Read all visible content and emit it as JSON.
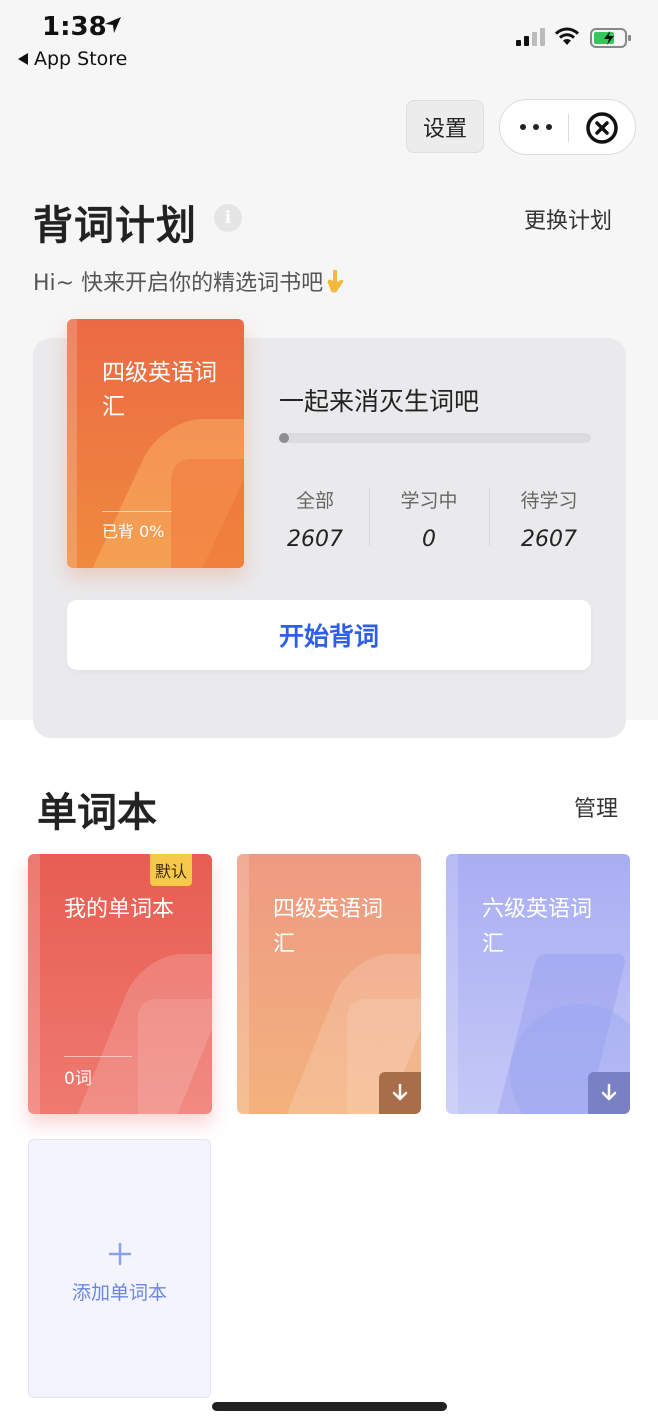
{
  "status_bar": {
    "time": "1:38",
    "back_label": "App Store"
  },
  "capsule": {
    "settings_label": "设置"
  },
  "plan": {
    "title": "背词计划",
    "info_icon": "i",
    "change_label": "更换计划",
    "greeting": "Hi~ 快来开启你的精选词书吧",
    "book": {
      "title": "四级英语词汇",
      "progress_text": "已背 0%"
    },
    "card_heading": "一起来消灭生词吧",
    "progress_fraction": 0,
    "stats": [
      {
        "label": "全部",
        "value": "2607"
      },
      {
        "label": "学习中",
        "value": "0"
      },
      {
        "label": "待学习",
        "value": "2607"
      }
    ],
    "start_label": "开始背词"
  },
  "wordbooks": {
    "title": "单词本",
    "manage_label": "管理",
    "items": [
      {
        "name": "我的单词本",
        "tag": "默认",
        "count": "0词"
      },
      {
        "name": "四级英语词汇"
      },
      {
        "name": "六级英语词汇"
      }
    ],
    "add_icon": "+",
    "add_label": "添加单词本"
  },
  "colors": {
    "accent_blue": "#2f5fe8",
    "plan_book": "#ec6a45",
    "my_book": "#e75d52",
    "cet4_book": "#ee9a82",
    "cet6_book": "#a9aef3"
  }
}
